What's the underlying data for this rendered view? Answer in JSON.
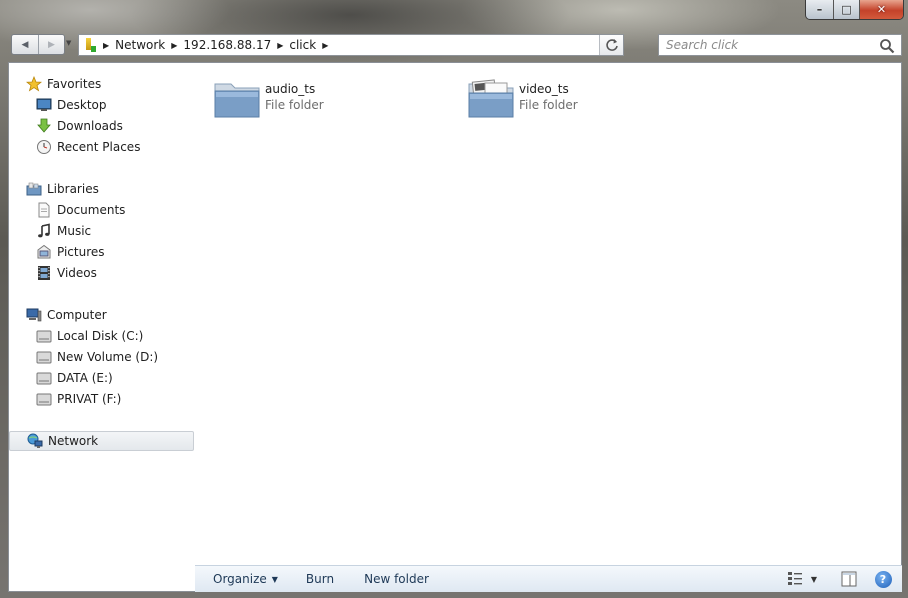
{
  "window": {
    "caption_glyphs": {
      "minimize": "–",
      "maximize": "□",
      "close": "✕"
    }
  },
  "address_bar": {
    "breadcrumbs": [
      "Network",
      "192.168.88.17",
      "click"
    ],
    "refresh_icon": "refresh-icon"
  },
  "search": {
    "placeholder": "Search click"
  },
  "nav_pane": {
    "favorites": {
      "label": "Favorites",
      "items": [
        "Desktop",
        "Downloads",
        "Recent Places"
      ]
    },
    "libraries": {
      "label": "Libraries",
      "items": [
        "Documents",
        "Music",
        "Pictures",
        "Videos"
      ]
    },
    "computer": {
      "label": "Computer",
      "items": [
        "Local Disk (C:)",
        "New Volume (D:)",
        "DATA (E:)",
        "PRIVAT (F:)"
      ]
    },
    "network": {
      "label": "Network",
      "selected": true
    }
  },
  "content": {
    "folders": [
      {
        "name": "audio_ts",
        "type": "File folder"
      },
      {
        "name": "video_ts",
        "type": "File folder"
      }
    ]
  },
  "command_bar": {
    "organize": "Organize",
    "burn": "Burn",
    "new_folder": "New folder",
    "help_glyph": "?"
  },
  "colors": {
    "accent": "#1e3957",
    "folder_blue": "#7a9ec6",
    "command_bar": "#e6eef6"
  }
}
